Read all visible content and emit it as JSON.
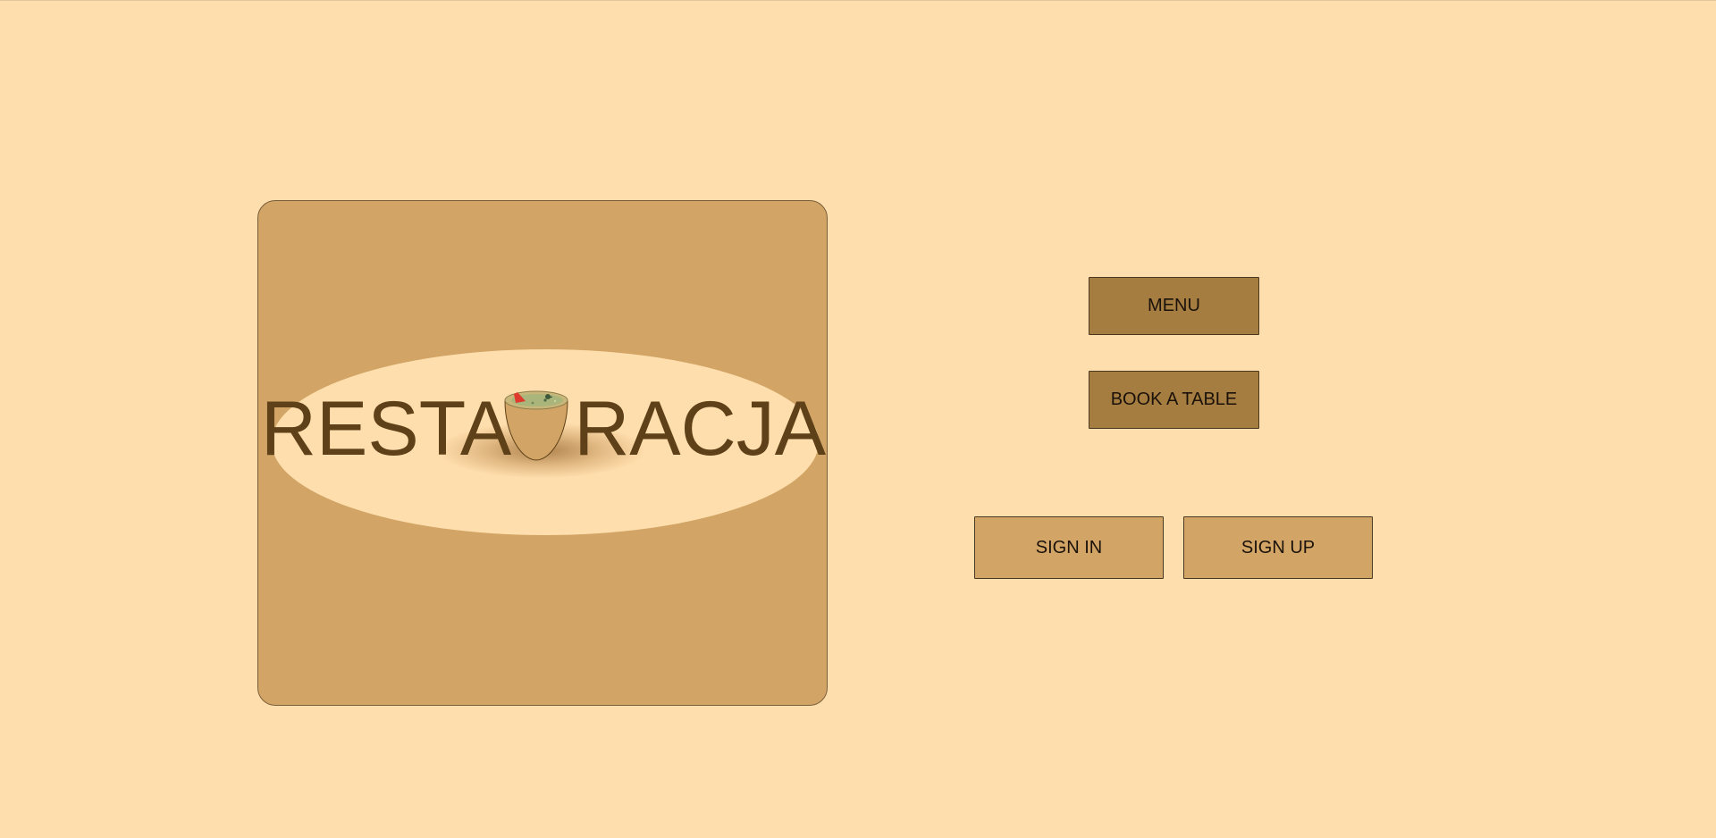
{
  "logo": {
    "text_left": "RESTA",
    "text_right": "RACJA",
    "bowl_icon": "salad-bowl-icon"
  },
  "nav": {
    "menu_label": "MENU",
    "book_label": "BOOK A TABLE"
  },
  "auth": {
    "sign_in_label": "SIGN IN",
    "sign_up_label": "SIGN UP"
  },
  "colors": {
    "background": "#FFDEAD",
    "card": "#D2A566",
    "primary_button": "#A67D40",
    "secondary_button": "#D2A566",
    "logo_text": "#5E4118"
  }
}
